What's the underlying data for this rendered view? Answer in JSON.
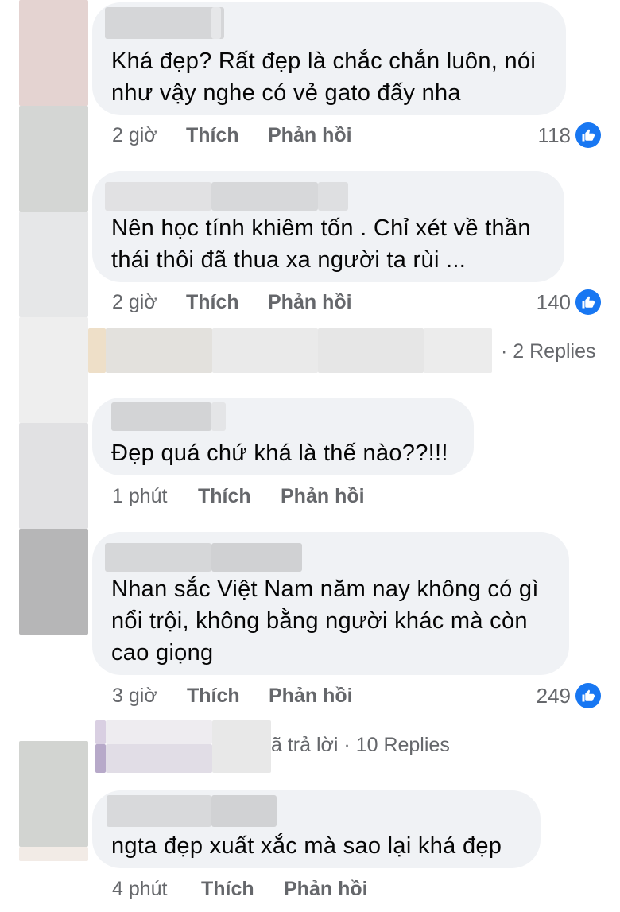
{
  "comments": [
    {
      "text": "Khá đẹp? Rất đẹp là chắc chắn luôn, nói như vậy nghe có vẻ gato đấy nha",
      "line1": "Khá đẹp? Rất đẹp là chắc chắn luôn, nói",
      "line2": "như vậy nghe có vẻ gato đấy nha",
      "time": "2 giờ",
      "like_label": "Thích",
      "reply_label": "Phản hồi",
      "reaction_count": "118"
    },
    {
      "line1": "Nên học tính khiêm tốn . Chỉ xét về thần",
      "line2": "thái thôi đã thua xa người ta rùi ...",
      "time": "2 giờ",
      "like_label": "Thích",
      "reply_label": "Phản hồi",
      "reaction_count": "140",
      "replies_label": "· 2 Replies"
    },
    {
      "line1": "Đẹp quá chứ khá là thế nào??!!!",
      "time": "1 phút",
      "like_label": "Thích",
      "reply_label": "Phản hồi"
    },
    {
      "line1": "Nhan sắc Việt Nam năm nay không có gì",
      "line2": "nổi trội, không bằng người khác mà còn",
      "line3": "cao giọng",
      "time": "3 giờ",
      "like_label": "Thích",
      "reply_label": "Phản hồi",
      "reaction_count": "249",
      "replies_label": "ã trả lời · 10 Replies"
    },
    {
      "line1": "ngta đẹp  xuất xắc mà sao lại khá đẹp",
      "time": "4 phút",
      "like_label": "Thích",
      "reply_label": "Phản hồi"
    }
  ],
  "colors": {
    "bubble": "#f0f2f5",
    "meta_text": "#65676b",
    "like_blue": "#1877f2"
  },
  "icons": {
    "reaction": "thumbs-up-icon"
  }
}
